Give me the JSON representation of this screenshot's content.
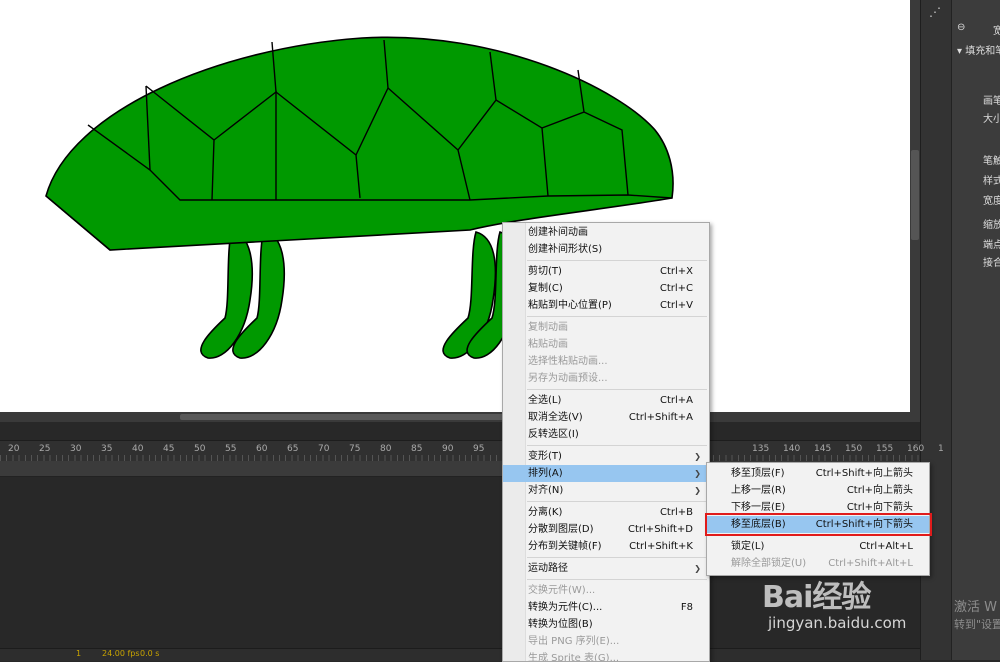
{
  "panel": {
    "lines": [
      "宽",
      "填充和笔",
      "画笔",
      "大小",
      "笔触",
      "样式",
      "宽度",
      "缩放",
      "端点",
      "接合"
    ]
  },
  "ruler": {
    "ticks": [
      "20",
      "25",
      "30",
      "35",
      "40",
      "45",
      "50",
      "55",
      "60",
      "65",
      "70",
      "75",
      "80",
      "85",
      "90",
      "95",
      "",
      "",
      "",
      "",
      "",
      "",
      "",
      "",
      "135",
      "140",
      "145",
      "150",
      "155",
      "160",
      "1"
    ]
  },
  "timeline_status": {
    "frame": "1",
    "fps": "24.00 fps",
    "time": "0.0 s"
  },
  "context_menu": {
    "items": [
      {
        "label": "创建补间动画",
        "shortcut": "",
        "disabled": false
      },
      {
        "label": "创建补间形状(S)",
        "shortcut": "",
        "disabled": false
      },
      {
        "sep": true
      },
      {
        "label": "剪切(T)",
        "shortcut": "Ctrl+X",
        "disabled": false
      },
      {
        "label": "复制(C)",
        "shortcut": "Ctrl+C",
        "disabled": false
      },
      {
        "label": "粘贴到中心位置(P)",
        "shortcut": "Ctrl+V",
        "disabled": false
      },
      {
        "sep": true
      },
      {
        "label": "复制动画",
        "shortcut": "",
        "disabled": true
      },
      {
        "label": "粘贴动画",
        "shortcut": "",
        "disabled": true
      },
      {
        "label": "选择性粘贴动画...",
        "shortcut": "",
        "disabled": true
      },
      {
        "label": "另存为动画预设...",
        "shortcut": "",
        "disabled": true
      },
      {
        "sep": true
      },
      {
        "label": "全选(L)",
        "shortcut": "Ctrl+A",
        "disabled": false
      },
      {
        "label": "取消全选(V)",
        "shortcut": "Ctrl+Shift+A",
        "disabled": false
      },
      {
        "label": "反转选区(I)",
        "shortcut": "",
        "disabled": false
      },
      {
        "sep": true
      },
      {
        "label": "变形(T)",
        "shortcut": "",
        "disabled": false,
        "submenu": true
      },
      {
        "label": "排列(A)",
        "shortcut": "",
        "disabled": false,
        "submenu": true,
        "highlighted": true
      },
      {
        "label": "对齐(N)",
        "shortcut": "",
        "disabled": false,
        "submenu": true
      },
      {
        "sep": true
      },
      {
        "label": "分离(K)",
        "shortcut": "Ctrl+B",
        "disabled": false
      },
      {
        "label": "分散到图层(D)",
        "shortcut": "Ctrl+Shift+D",
        "disabled": false
      },
      {
        "label": "分布到关键帧(F)",
        "shortcut": "Ctrl+Shift+K",
        "disabled": false
      },
      {
        "sep": true
      },
      {
        "label": "运动路径",
        "shortcut": "",
        "disabled": false,
        "submenu": true
      },
      {
        "sep": true
      },
      {
        "label": "交换元件(W)...",
        "shortcut": "",
        "disabled": true
      },
      {
        "label": "转换为元件(C)...",
        "shortcut": "F8",
        "disabled": false
      },
      {
        "label": "转换为位图(B)",
        "shortcut": "",
        "disabled": false
      },
      {
        "label": "导出 PNG 序列(E)...",
        "shortcut": "",
        "disabled": true
      },
      {
        "label": "生成 Sprite 表(G)...",
        "shortcut": "",
        "disabled": true
      }
    ]
  },
  "submenu": {
    "items": [
      {
        "label": "移至顶层(F)",
        "shortcut": "Ctrl+Shift+向上箭头",
        "disabled": false
      },
      {
        "label": "上移一层(R)",
        "shortcut": "Ctrl+向上箭头",
        "disabled": false
      },
      {
        "label": "下移一层(E)",
        "shortcut": "Ctrl+向下箭头",
        "disabled": false
      },
      {
        "label": "移至底层(B)",
        "shortcut": "Ctrl+Shift+向下箭头",
        "disabled": false,
        "highlighted": true
      },
      {
        "sep": true
      },
      {
        "label": "锁定(L)",
        "shortcut": "Ctrl+Alt+L",
        "disabled": false
      },
      {
        "label": "解除全部锁定(U)",
        "shortcut": "Ctrl+Shift+Alt+L",
        "disabled": true
      }
    ]
  },
  "watermark": {
    "logo": "Bai经验",
    "url": "jingyan.baidu.com"
  },
  "activate": {
    "line1": "激活 W",
    "line2": "转到\"设置"
  },
  "colors": {
    "turtle_fill": "#009900",
    "menu_highlight": "#97c6f0",
    "callout_border": "#e01b1b"
  }
}
